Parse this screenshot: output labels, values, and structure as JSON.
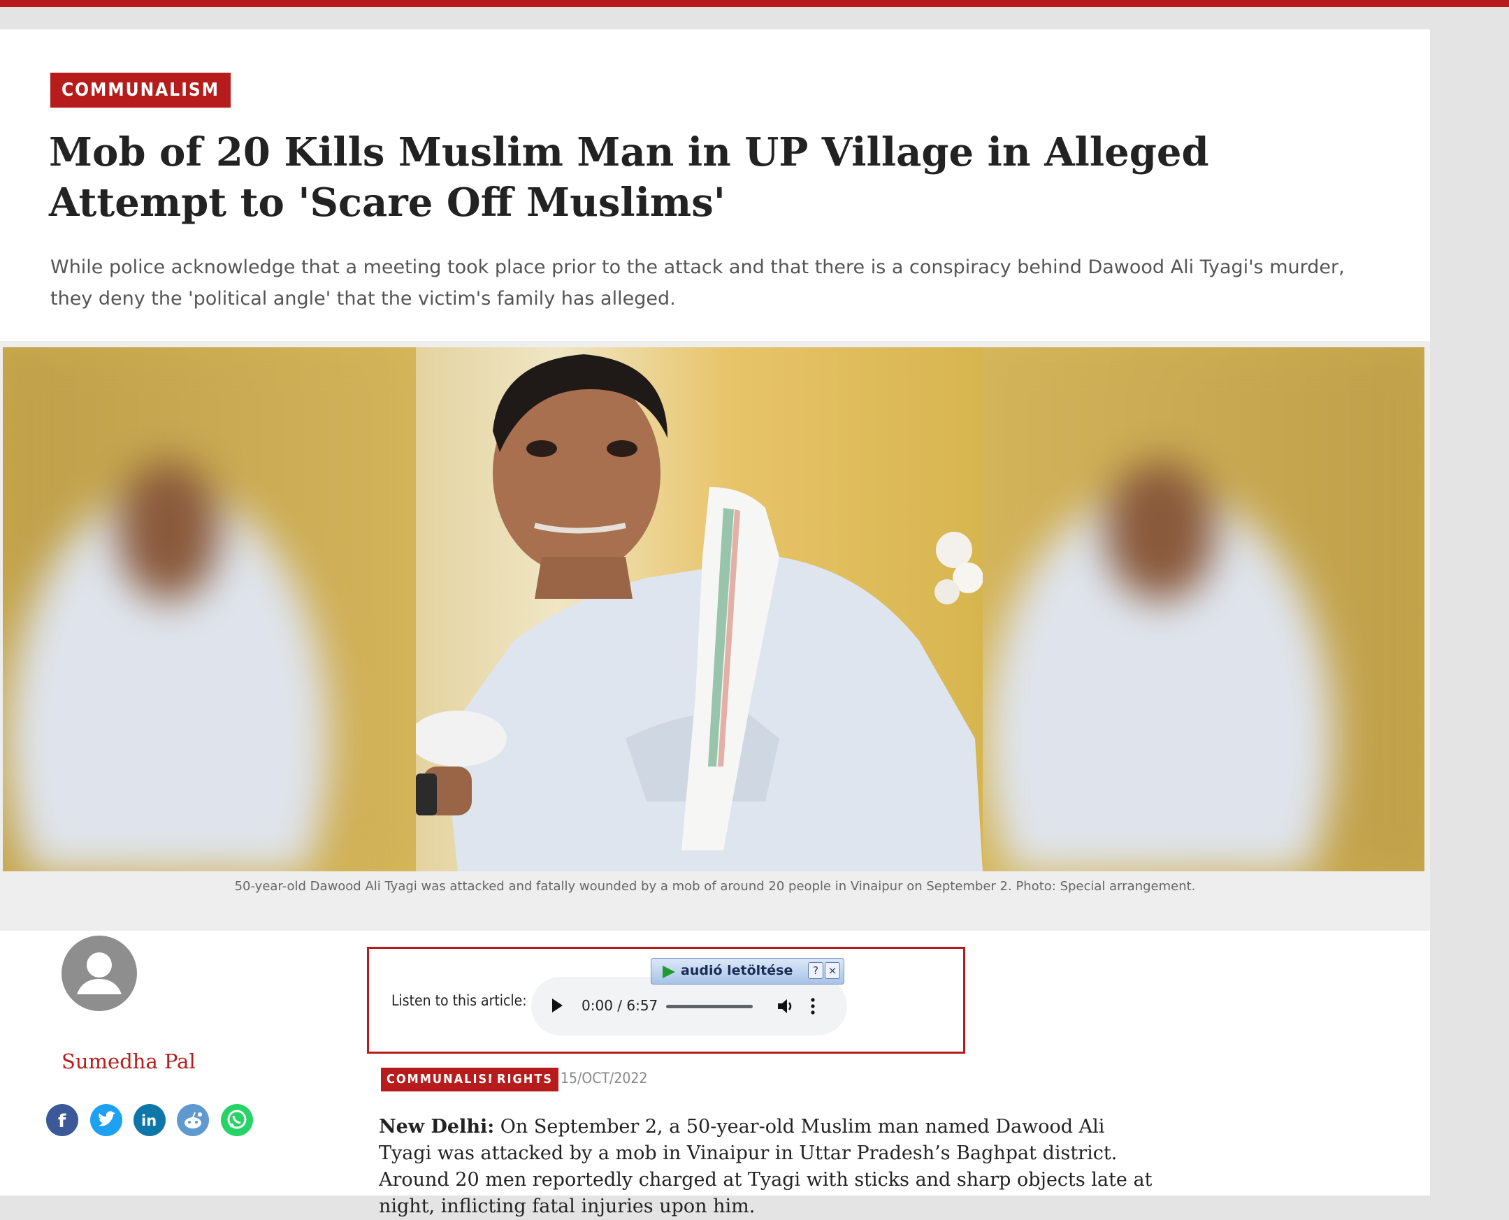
{
  "category_badge": "COMMUNALISM",
  "headline": "Mob of 20 Kills Muslim Man in UP Village in Alleged Attempt to 'Scare Off Muslims'",
  "dek": "While police acknowledge that a meeting took place prior to the attack and that there is a conspiracy behind Dawood Ali Tyagi's murder, they deny the 'political angle' that the victim's family has alleged.",
  "photo": {
    "caption": "50-year-old Dawood Ali Tyagi was attacked and fatally wounded by a mob of around 20 people in Vinaipur on September 2. Photo: Special arrangement."
  },
  "author": {
    "name": "Sumedha Pal"
  },
  "share": [
    "facebook-icon",
    "twitter-icon",
    "linkedin-icon",
    "reddit-icon",
    "whatsapp-icon"
  ],
  "audio": {
    "listen_label": "Listen to this article:",
    "time": "0:00 / 6:57",
    "download_label": "audió  letöltése",
    "help_label": "?",
    "close_label": "×"
  },
  "tags": [
    "COMMUNALISM",
    "RIGHTS"
  ],
  "date": "15/OCT/2022",
  "body": {
    "dateline": "New Delhi:",
    "text": " On September 2, a 50-year-old Muslim man named Dawood Ali Tyagi was attacked by a mob in Vinaipur in Uttar Pradesh’s Baghpat district. Around 20 men reportedly charged at Tyagi with sticks and sharp objects late at night, inflicting fatal injuries upon him."
  },
  "colors": {
    "brand_red": "#b71c1c",
    "page_bg": "#e4e4e4"
  }
}
